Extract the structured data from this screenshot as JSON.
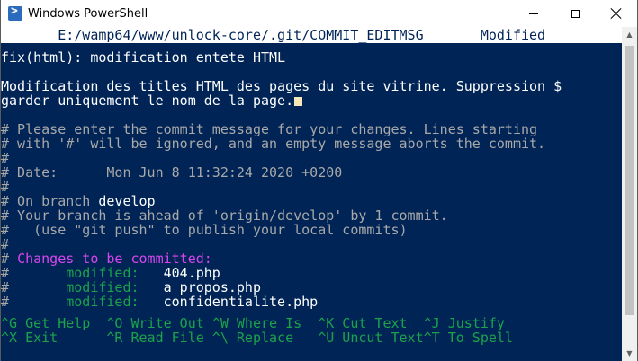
{
  "window": {
    "title": "Windows PowerShell",
    "icon": "powershell-icon"
  },
  "nano": {
    "status_path": "E:/wamp64/www/unlock-core/.git/COMMIT_EDITMSG",
    "status_state": "Modified",
    "lines": {
      "subject": "fix(html): modification entete HTML",
      "body1": "Modification des titles HTML des pages du site vitrine. Suppression $",
      "body2": "garder uniquement le nom de la page.",
      "c1": "# Please enter the commit message for your changes. Lines starting",
      "c2": "# with '#' will be ignored, and an empty message aborts the commit.",
      "c3": "#",
      "c4": "# Date:      Mon Jun 8 11:32:24 2020 +0200",
      "c5": "#",
      "c6_prefix": "# On branch ",
      "c6_branch": "develop",
      "c7": "# Your branch is ahead of 'origin/develop' by 1 commit.",
      "c8": "#   (use \"git push\" to publish your local commits)",
      "c9": "#",
      "c10_prefix": "# ",
      "c10_label": "Changes to be committed:",
      "files": [
        {
          "hash": "#",
          "status": "modified:",
          "name": "404.php"
        },
        {
          "hash": "#",
          "status": "modified:",
          "name": "a_propos.php"
        },
        {
          "hash": "#",
          "status": "modified:",
          "name": "confidentialite.php"
        }
      ]
    },
    "help_row1": "^G Get Help  ^O Write Out ^W Where Is  ^K Cut Text  ^J Justify",
    "help_row2": "^X Exit      ^R Read File ^\\ Replace   ^U Uncut Text^T To Spell"
  },
  "colors": {
    "background": "#012456",
    "comment": "#a8a8a8",
    "magenta": "#d946ef",
    "green": "#1aa34a"
  }
}
